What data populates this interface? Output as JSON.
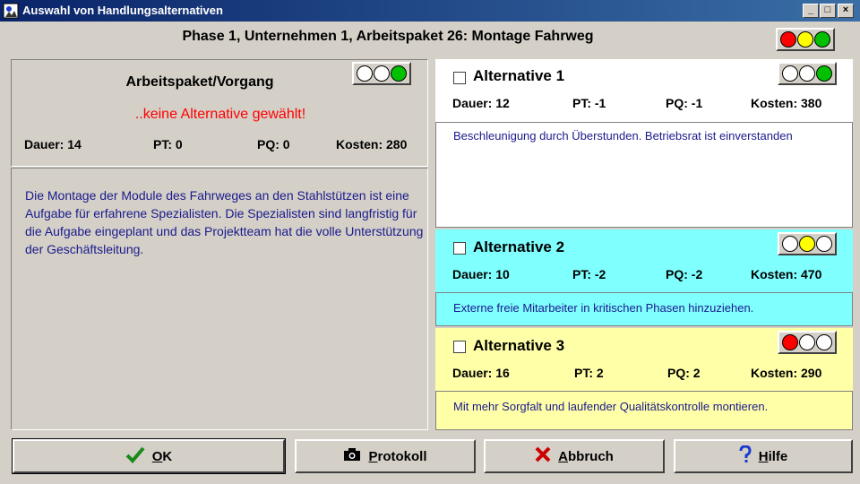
{
  "window": {
    "title": "Auswahl von Handlungsalternativen",
    "minimize": "_",
    "maximize": "□",
    "close": "×"
  },
  "heading": "Phase 1, Unternehmen 1, Arbeitspaket 26: Montage Fahrweg",
  "header_lights": [
    "red",
    "yellow",
    "green"
  ],
  "task": {
    "title": "Arbeitspaket/Vorgang",
    "status": "..keine Alternative gewählt!",
    "lights": [
      "off",
      "off",
      "green"
    ],
    "dauer": "Dauer: 14",
    "pt": "PT: 0",
    "pq": "PQ: 0",
    "kosten": "Kosten: 280",
    "description": "Die Montage der Module des Fahrweges an den Stahlstützen ist eine Aufgabe für erfahrene Spezialisten. Die Spezialisten sind langfristig für die Aufgabe eingeplant und das Projektteam hat die volle Unterstützung der Geschäftsleitung."
  },
  "alternatives": [
    {
      "title": "Alternative 1",
      "checked": false,
      "bg": "#ffffff",
      "lights": [
        "off",
        "off",
        "green"
      ],
      "dauer": "Dauer: 12",
      "pt": "PT: -1",
      "pq": "PQ: -1",
      "kosten": "Kosten: 380",
      "description": "Beschleunigung durch Überstunden. Betriebsrat ist einverstanden"
    },
    {
      "title": "Alternative 2",
      "checked": false,
      "bg": "#80ffff",
      "lights": [
        "off",
        "yellow",
        "off"
      ],
      "dauer": "Dauer: 10",
      "pt": "PT: -2",
      "pq": "PQ: -2",
      "kosten": "Kosten: 470",
      "description": "Externe freie Mitarbeiter in kritischen Phasen hinzuziehen."
    },
    {
      "title": "Alternative 3",
      "checked": false,
      "bg": "#ffffa8",
      "lights": [
        "red",
        "off",
        "off"
      ],
      "dauer": "Dauer: 16",
      "pt": "PT: 2",
      "pq": "PQ: 2",
      "kosten": "Kosten: 290",
      "description": "Mit mehr Sorgfalt und laufender Qualitätskontrolle montieren."
    }
  ],
  "buttons": {
    "ok": {
      "mnemonic": "O",
      "rest": "K"
    },
    "protokoll": {
      "mnemonic": "P",
      "rest": "rotokoll"
    },
    "abbruch": {
      "mnemonic": "A",
      "rest": "bbruch"
    },
    "hilfe": {
      "mnemonic": "H",
      "rest": "ilfe"
    }
  },
  "colors": {
    "title_bar": "#0a246a",
    "status_red": "#ff0000",
    "desc_text": "#1a1a8c",
    "ok_check": "#1a8a1a",
    "cancel_x": "#cc0000",
    "help_q": "#1a3ad0"
  }
}
